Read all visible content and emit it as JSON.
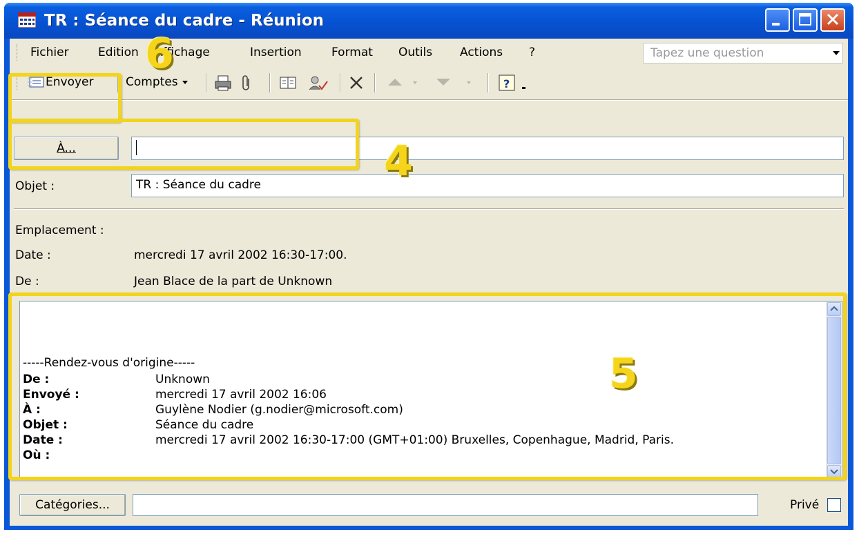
{
  "window": {
    "title": "TR : Séance du cadre - Réunion"
  },
  "menu": {
    "items": [
      "Fichier",
      "Edition",
      "Affichage",
      "Insertion",
      "Format",
      "Outils",
      "Actions",
      "?"
    ],
    "ask_placeholder": "Tapez une question"
  },
  "toolbar": {
    "send_label": "Envoyer",
    "accounts_label": "Comptes"
  },
  "header": {
    "to_button": "À...",
    "to_value": "",
    "subject_label": "Objet :",
    "subject_value": "TR : Séance du cadre",
    "location_label": "Emplacement :",
    "date_label": "Date :",
    "date_value": "mercredi 17 avril 2002 16:30-17:00.",
    "from_label": "De :",
    "from_value": "Jean Blace de la part de Unknown"
  },
  "body": {
    "separator": "-----Rendez-vous d'origine-----",
    "rows": [
      {
        "key": "De :",
        "value": "Unknown"
      },
      {
        "key": "Envoyé :",
        "value": "mercredi 17 avril 2002 16:06"
      },
      {
        "key": "À :",
        "value": "Guylène Nodier (g.nodier@microsoft.com)"
      },
      {
        "key": "Objet :",
        "value": "Séance du cadre"
      },
      {
        "key": "Date :",
        "value": "mercredi 17 avril 2002 16:30-17:00 (GMT+01:00) Bruxelles, Copenhague, Madrid, Paris."
      },
      {
        "key": "Où :",
        "value": ""
      }
    ]
  },
  "footer": {
    "categories_button": "Catégories...",
    "categories_value": "",
    "private_label": "Privé"
  },
  "annotations": {
    "n6": "6",
    "n4": "4",
    "n5": "5"
  },
  "colors": {
    "highlight": "#f3d41a",
    "titlebar": "#0a57d8",
    "chrome": "#ece9d8"
  }
}
